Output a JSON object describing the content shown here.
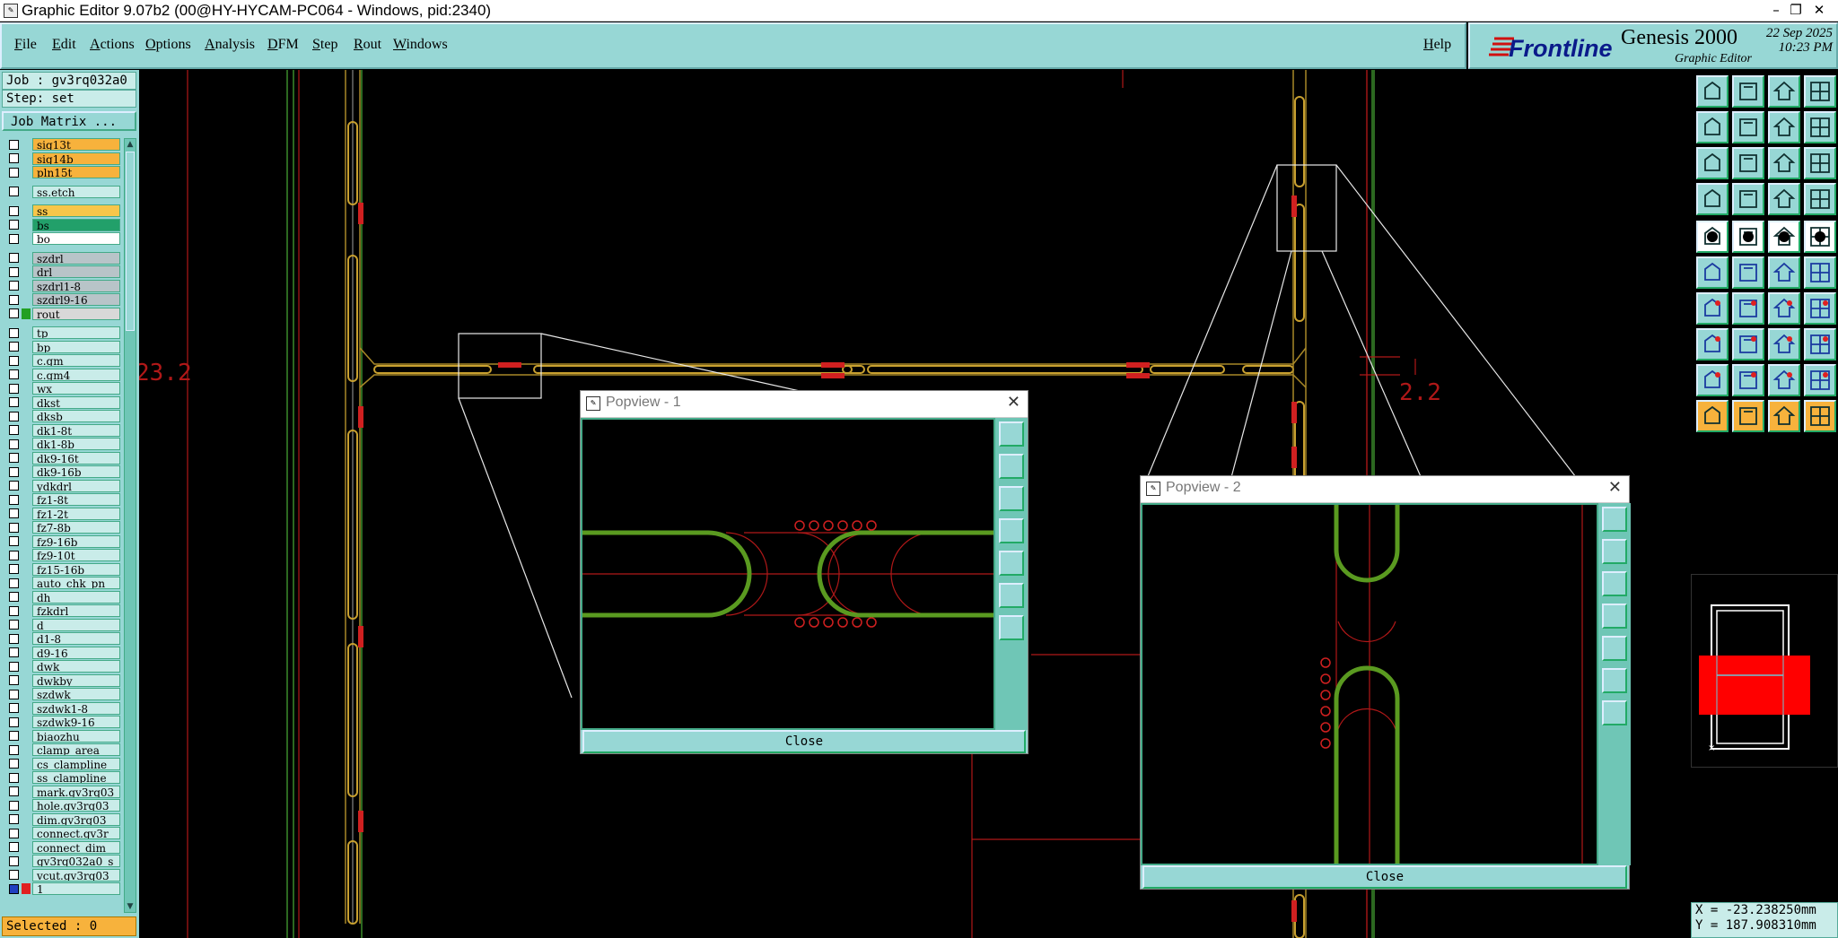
{
  "window": {
    "title": "Graphic Editor 9.07b2 (00@HY-HYCAM-PC064 - Windows, pid:2340)",
    "controls": [
      "–",
      "❐",
      "✕"
    ]
  },
  "menu": {
    "items": [
      {
        "u": "F",
        "rest": "ile"
      },
      {
        "u": "E",
        "rest": "dit"
      },
      {
        "u": "A",
        "rest": "ctions"
      },
      {
        "u": "O",
        "rest": "ptions"
      },
      {
        "u": "A",
        "rest": "nalysis"
      },
      {
        "u": "D",
        "rest": "FM"
      },
      {
        "u": "S",
        "rest": "tep"
      },
      {
        "u": "R",
        "rest": "out"
      },
      {
        "u": "W",
        "rest": "indows"
      }
    ],
    "help": {
      "u": "H",
      "rest": "elp"
    }
  },
  "brand": {
    "logo": "Frontline",
    "product": "Genesis 2000",
    "subtitle": "Graphic Editor",
    "date": "22 Sep 2025",
    "time": "10:23 PM"
  },
  "left": {
    "job": "Job : gv3rq032a0",
    "step": "Step: set",
    "job_matrix": "Job Matrix ...",
    "selected": "Selected : 0",
    "layers": [
      {
        "name": "sig13t",
        "color": "#f7b23c"
      },
      {
        "name": "sig14b",
        "color": "#f7b23c"
      },
      {
        "name": "pln15t",
        "color": "#f7b23c"
      },
      {
        "name": "ss.etch",
        "color": "#c9ece9",
        "gap": true
      },
      {
        "name": "ss",
        "color": "#f7c64a",
        "gap": true
      },
      {
        "name": "bs",
        "color": "#22a06a"
      },
      {
        "name": "bo",
        "color": "#ffffff"
      },
      {
        "name": "szdrl",
        "color": "#b8c4c8",
        "gap": true
      },
      {
        "name": "drl",
        "color": "#b8c4c8"
      },
      {
        "name": "szdrl1-8",
        "color": "#b8c4c8"
      },
      {
        "name": "szdrl9-16",
        "color": "#b8c4c8"
      },
      {
        "name": "rout",
        "color": "#d8d8d8",
        "swatch": "#22a022"
      },
      {
        "name": "tp",
        "color": "#c9ece9",
        "gap": true
      },
      {
        "name": "bp",
        "color": "#c9ece9"
      },
      {
        "name": "c.gm",
        "color": "#c9ece9"
      },
      {
        "name": "c.gm4",
        "color": "#c9ece9"
      },
      {
        "name": "wx",
        "color": "#c9ece9"
      },
      {
        "name": "dkst",
        "color": "#c9ece9"
      },
      {
        "name": "dksb",
        "color": "#c9ece9"
      },
      {
        "name": "dk1-8t",
        "color": "#c9ece9"
      },
      {
        "name": "dk1-8b",
        "color": "#c9ece9"
      },
      {
        "name": "dk9-16t",
        "color": "#c9ece9"
      },
      {
        "name": "dk9-16b",
        "color": "#c9ece9"
      },
      {
        "name": "ydkdrl",
        "color": "#c9ece9"
      },
      {
        "name": "fz1-8t",
        "color": "#c9ece9"
      },
      {
        "name": "fz1-2t",
        "color": "#c9ece9"
      },
      {
        "name": "fz7-8b",
        "color": "#c9ece9"
      },
      {
        "name": "fz9-16b",
        "color": "#c9ece9"
      },
      {
        "name": "fz9-10t",
        "color": "#c9ece9"
      },
      {
        "name": "fz15-16b",
        "color": "#c9ece9"
      },
      {
        "name": "auto_chk_pn",
        "color": "#c9ece9"
      },
      {
        "name": "dh",
        "color": "#c9ece9"
      },
      {
        "name": "fzkdrl",
        "color": "#c9ece9"
      },
      {
        "name": "d",
        "color": "#c9ece9"
      },
      {
        "name": "d1-8",
        "color": "#c9ece9"
      },
      {
        "name": "d9-16",
        "color": "#c9ece9"
      },
      {
        "name": "dwk",
        "color": "#c9ece9"
      },
      {
        "name": "dwkby",
        "color": "#c9ece9"
      },
      {
        "name": "szdwk",
        "color": "#c9ece9"
      },
      {
        "name": "szdwk1-8",
        "color": "#c9ece9"
      },
      {
        "name": "szdwk9-16",
        "color": "#c9ece9"
      },
      {
        "name": "biaozhu",
        "color": "#c9ece9"
      },
      {
        "name": "clamp_area",
        "color": "#c9ece9"
      },
      {
        "name": "cs_clampline",
        "color": "#c9ece9"
      },
      {
        "name": "ss_clampline",
        "color": "#c9ece9"
      },
      {
        "name": "mark.gv3rq03",
        "color": "#c9ece9"
      },
      {
        "name": "hole.gv3rq03",
        "color": "#c9ece9"
      },
      {
        "name": "dim.gv3rq03",
        "color": "#c9ece9"
      },
      {
        "name": "connect.gv3r",
        "color": "#c9ece9"
      },
      {
        "name": "connect_dim",
        "color": "#c9ece9"
      },
      {
        "name": "gv3rq032a0_s",
        "color": "#c9ece9"
      },
      {
        "name": "vcut.gv3rq03",
        "color": "#c9ece9"
      },
      {
        "name": "1",
        "color": "#c9ece9",
        "swatch": "#e02020",
        "cbfill": "#2040c0"
      }
    ]
  },
  "canvas": {
    "dim_left": "23.2",
    "dim_right": "2.2"
  },
  "popview1": {
    "title": "Popview - 1",
    "close": "Close"
  },
  "popview2": {
    "title": "Popview - 2",
    "close": "Close"
  },
  "coords": {
    "x": "X = -23.238250mm",
    "y": "Y = 187.908310mm"
  },
  "icons": {
    "toolbar": [
      "open-job-icon",
      "save-icon",
      "home-icon",
      "layout-icon",
      "copy-in-icon",
      "copy-out-icon",
      "snap-icon",
      "wave-icon",
      "zoom-fit-icon",
      "zoom-center-icon",
      "scale-one-icon",
      "help-icon",
      "settings-icon",
      "pin-icon",
      "layers-a-icon",
      "layers-b-icon",
      "black-dot-icon",
      "corner-icon",
      "ruler-icon",
      "circle-fill-icon",
      "nodes-icon",
      "cross-nodes-icon",
      "move-node-icon",
      "slant-node-icon",
      "angle-icon",
      "diagonal-icon",
      "rotate-icon",
      "split-icon",
      "grid-point-icon",
      "hline-icon",
      "box-center-icon",
      "group-icon",
      "arc-a-icon",
      "arc-b-icon",
      "arc-c-icon",
      "arc-d-icon",
      "pointer-a-icon",
      "pointer-b-icon",
      "pointer-c-icon",
      "pointer-d-icon"
    ]
  }
}
